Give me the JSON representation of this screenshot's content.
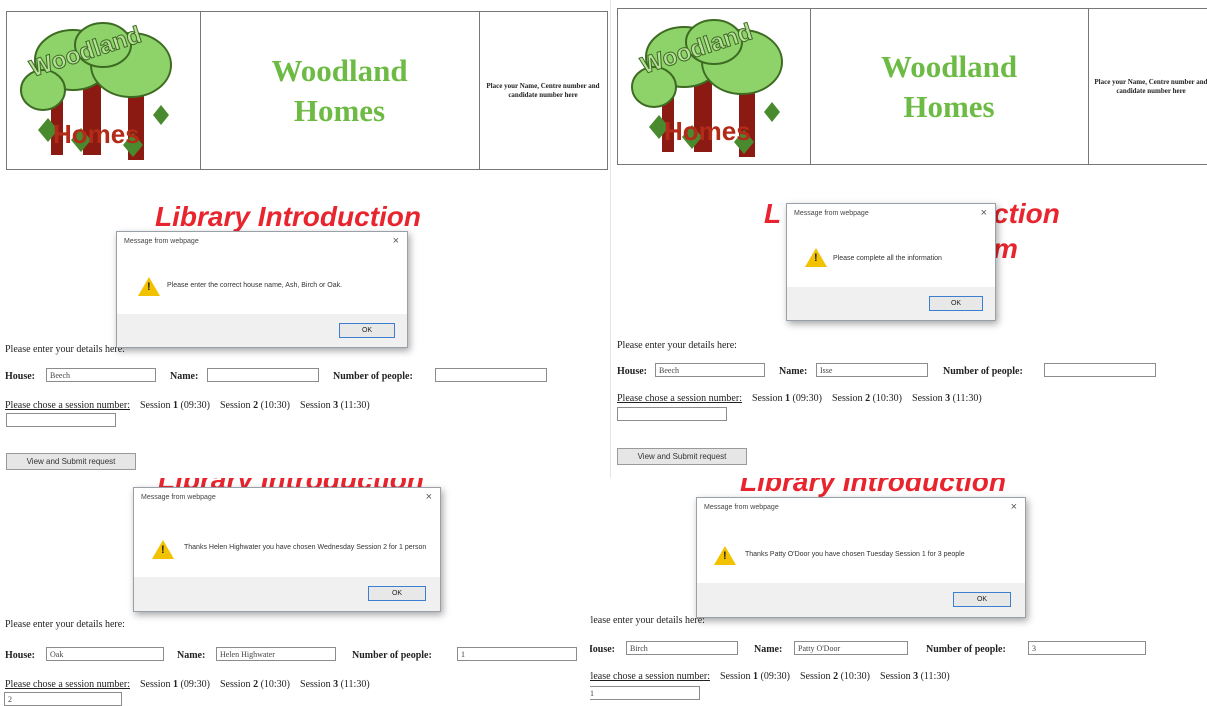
{
  "header": {
    "brand_line1": "Woodland",
    "brand_line2": "Homes",
    "note_left": "Place your Name, Centre number and candidate number here",
    "note_right": "Place your Name, Centre number and candidate number here",
    "logo_text_top": "Woodland",
    "logo_text_bottom": "Homes"
  },
  "page": {
    "title": "Library Introduction",
    "title_right_visible_left": "L",
    "title_right_visible_right": "ction",
    "title_right_line2": "m",
    "intro": "Please enter your details here:",
    "house_label": "House:",
    "name_label": "Name:",
    "people_label": "Number of people:",
    "session_prompt": "Please chose a session number:",
    "session_word": "Session",
    "s1": "1",
    "s1_time": "(09:30)",
    "s2": "2",
    "s2_time": "(10:30)",
    "s3": "3",
    "s3_time": "(11:30)",
    "submit": "View and Submit request"
  },
  "dialog": {
    "title": "Message from webpage",
    "close": "×",
    "ok": "OK",
    "warning_glyph": "!"
  },
  "panels": {
    "tl": {
      "house": "Beech",
      "name": "",
      "people": "",
      "session": "",
      "message": "Please enter the correct house name, Ash, Birch or Oak."
    },
    "tr": {
      "house": "Beech",
      "name": "Isse",
      "people": "",
      "session": "",
      "message": "Please complete all the information"
    },
    "bl": {
      "house": "Oak",
      "name": "Helen Highwater",
      "people": "1",
      "session": "2",
      "message": "Thanks Helen Highwater you have chosen Wednesday Session 2 for 1 person"
    },
    "br": {
      "house": "Birch",
      "name": "Patty O'Door",
      "people": "3",
      "session": "1",
      "message": "Thanks Patty O'Door you have chosen Tuesday Session 1 for 3 people"
    }
  },
  "colors": {
    "brand_green": "#6dbb45",
    "title_red": "#e8252e",
    "warning_yellow": "#f2c200"
  }
}
